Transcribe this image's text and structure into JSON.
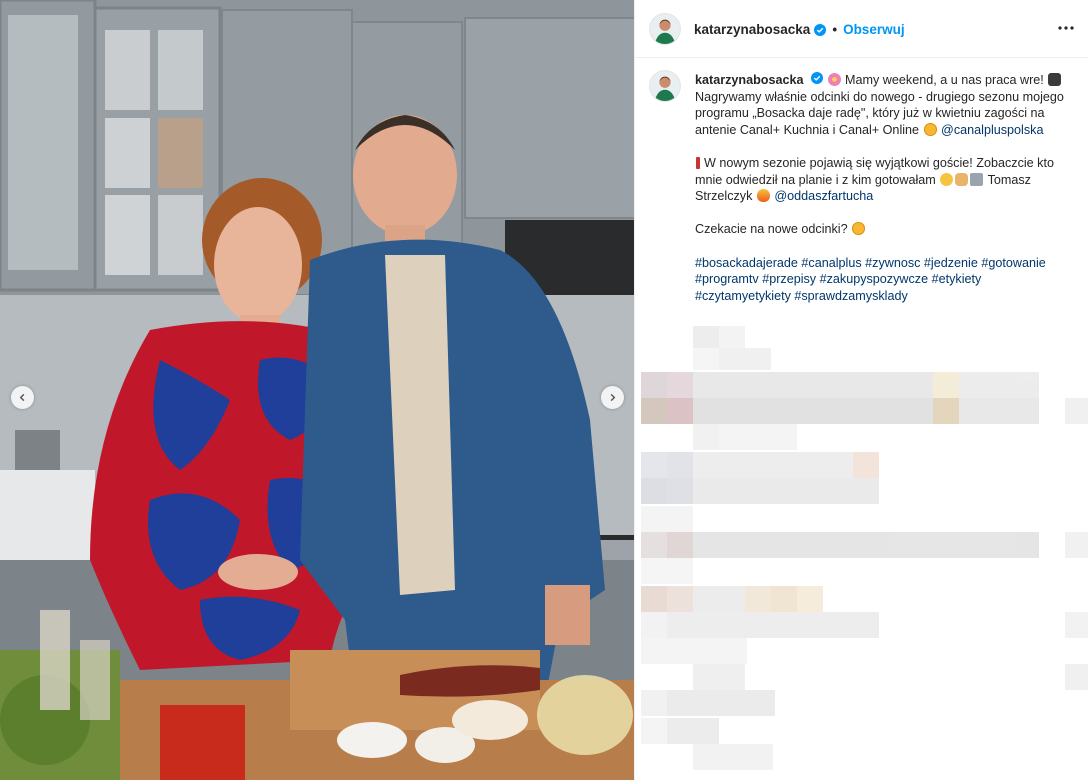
{
  "photo": {
    "alt": "Katarzyna Bosacka and Tomasz Strzelczyk in a kitchen"
  },
  "header": {
    "username": "katarzynabosacka",
    "separator": "•",
    "follow_label": "Obserwuj",
    "more_icon": "more-horizontal-icon"
  },
  "caption": {
    "username": "katarzynabosacka",
    "line1": "Mamy weekend, a u nas praca wre!",
    "line2": "Nagrywamy właśnie odcinki do nowego - drugiego sezonu mojego programu „Bosacka daje radę\", który już w kwietniu zagości na antenie Canal+ Kuchnia i Canal+ Online",
    "mention1": "@canalpluspolska",
    "para2": "W nowym sezonie pojawią się wyjątkowi goście! Zobaczcie kto mnie odwiedził na planie i z kim gotowałam",
    "para2_name": "Tomasz Strzelczyk",
    "mention2": "@oddaszfartucha",
    "para3": "Czekacie na nowe odcinki?",
    "hashtags": "#bosackadajerade #canalplus #zywnosc #jedzenie #gotowanie #programtv #przepisy #zakupyspozywcze #etykiety #czytamyetykiety #sprawdzamysklady"
  },
  "colors": {
    "accent": "#0095f6",
    "link": "#00376b",
    "text": "#262626",
    "border": "#efefef"
  }
}
